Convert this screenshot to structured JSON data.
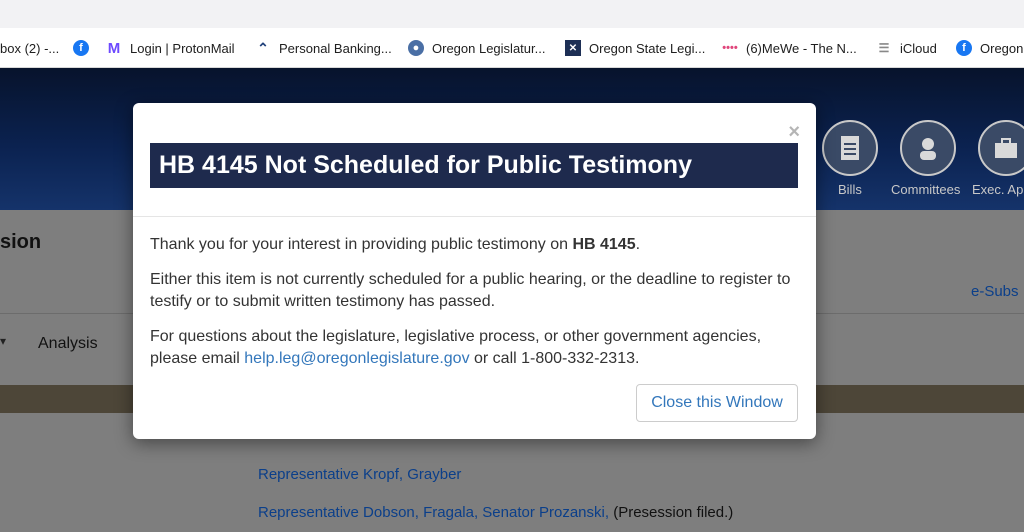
{
  "bookmarks": [
    {
      "label": "box (2) -...",
      "icon": "mail-icon"
    },
    {
      "label": "",
      "icon": "facebook-icon"
    },
    {
      "label": "Login | ProtonMail",
      "icon": "protonmail-icon"
    },
    {
      "label": "Personal Banking...",
      "icon": "bank-icon"
    },
    {
      "label": "Oregon Legislatur...",
      "icon": "oregon-seal-icon"
    },
    {
      "label": "Oregon State Legi...",
      "icon": "grid-icon"
    },
    {
      "label": "(6)MeWe - The N...",
      "icon": "mewe-icon"
    },
    {
      "label": "iCloud",
      "icon": "icloud-icon"
    },
    {
      "label": "Oregon",
      "icon": "facebook-icon"
    }
  ],
  "nav": {
    "bills_label": "Bills",
    "committees_label": "Committees",
    "exec_label": "Exec. Ap"
  },
  "page": {
    "session_title": "sion",
    "esubscribe": "e-Subs",
    "tab_analysis": "Analysis",
    "sponsors": [
      {
        "text": "Representative Kropf, Grayber",
        "note": ""
      },
      {
        "text": "Representative Dobson, Fragala, Senator Prozanski,",
        "note": "(Presession filed.)"
      }
    ]
  },
  "modal": {
    "close_symbol": "×",
    "title": "HB 4145 Not Scheduled for Public Testimony",
    "p1_text": "Thank you for your interest in providing public testimony on ",
    "p1_bill": "HB 4145",
    "p1_end": ".",
    "p2": "Either this item is not currently scheduled for a public hearing, or the deadline to register to testify or to submit written testimony has passed.",
    "p3_text": "For questions about the legislature, legislative process, or other government agencies, please email ",
    "p3_email": "help.leg@oregonlegislature.gov",
    "p3_end": " or call 1-800-332-2313.",
    "close_button": "Close this Window"
  },
  "colors": {
    "title_bg": "#1e2a4d",
    "link": "#3377bb",
    "banner": "#0b2250"
  }
}
